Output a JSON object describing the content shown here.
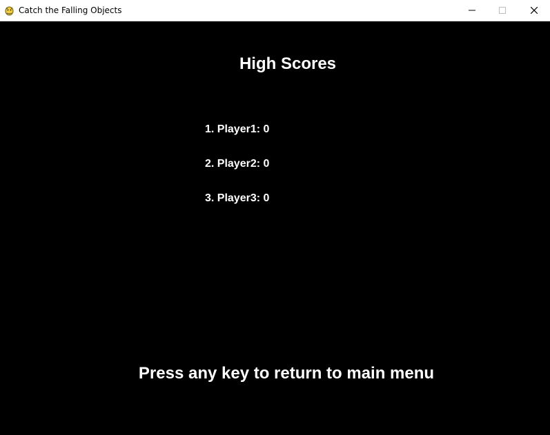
{
  "window": {
    "title": "Catch the Falling Objects",
    "app_icon": "pygame-snake-icon",
    "controls": [
      "minimize-icon",
      "maximize-icon",
      "close-icon"
    ]
  },
  "screen": {
    "heading": "High Scores",
    "scores": [
      "1. Player1: 0",
      "2. Player2: 0",
      "3. Player3: 0"
    ],
    "prompt": "Press any key to return to main menu"
  },
  "colors": {
    "background": "#000000",
    "text": "#ffffff",
    "titlebar": "#ffffff"
  }
}
